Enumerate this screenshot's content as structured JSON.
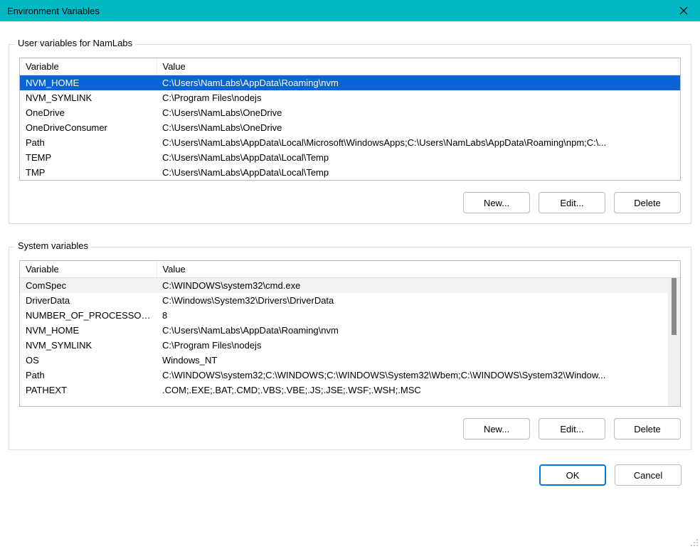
{
  "window": {
    "title": "Environment Variables"
  },
  "user_section": {
    "label": "User variables for NamLabs",
    "columns": {
      "name": "Variable",
      "value": "Value"
    },
    "rows": [
      {
        "name": "NVM_HOME",
        "value": "C:\\Users\\NamLabs\\AppData\\Roaming\\nvm",
        "selected": true
      },
      {
        "name": "NVM_SYMLINK",
        "value": "C:\\Program Files\\nodejs"
      },
      {
        "name": "OneDrive",
        "value": "C:\\Users\\NamLabs\\OneDrive"
      },
      {
        "name": "OneDriveConsumer",
        "value": "C:\\Users\\NamLabs\\OneDrive"
      },
      {
        "name": "Path",
        "value": "C:\\Users\\NamLabs\\AppData\\Local\\Microsoft\\WindowsApps;C:\\Users\\NamLabs\\AppData\\Roaming\\npm;C:\\..."
      },
      {
        "name": "TEMP",
        "value": "C:\\Users\\NamLabs\\AppData\\Local\\Temp"
      },
      {
        "name": "TMP",
        "value": "C:\\Users\\NamLabs\\AppData\\Local\\Temp"
      }
    ],
    "buttons": {
      "new": "New...",
      "edit": "Edit...",
      "delete": "Delete"
    }
  },
  "system_section": {
    "label": "System variables",
    "columns": {
      "name": "Variable",
      "value": "Value"
    },
    "rows": [
      {
        "name": "ComSpec",
        "value": "C:\\WINDOWS\\system32\\cmd.exe",
        "highlight": true
      },
      {
        "name": "DriverData",
        "value": "C:\\Windows\\System32\\Drivers\\DriverData"
      },
      {
        "name": "NUMBER_OF_PROCESSORS",
        "value": "8"
      },
      {
        "name": "NVM_HOME",
        "value": "C:\\Users\\NamLabs\\AppData\\Roaming\\nvm"
      },
      {
        "name": "NVM_SYMLINK",
        "value": "C:\\Program Files\\nodejs"
      },
      {
        "name": "OS",
        "value": "Windows_NT"
      },
      {
        "name": "Path",
        "value": "C:\\WINDOWS\\system32;C:\\WINDOWS;C:\\WINDOWS\\System32\\Wbem;C:\\WINDOWS\\System32\\Window..."
      },
      {
        "name": "PATHEXT",
        "value": ".COM;.EXE;.BAT;.CMD;.VBS;.VBE;.JS;.JSE;.WSF;.WSH;.MSC"
      }
    ],
    "buttons": {
      "new": "New...",
      "edit": "Edit...",
      "delete": "Delete"
    }
  },
  "footer": {
    "ok": "OK",
    "cancel": "Cancel"
  }
}
